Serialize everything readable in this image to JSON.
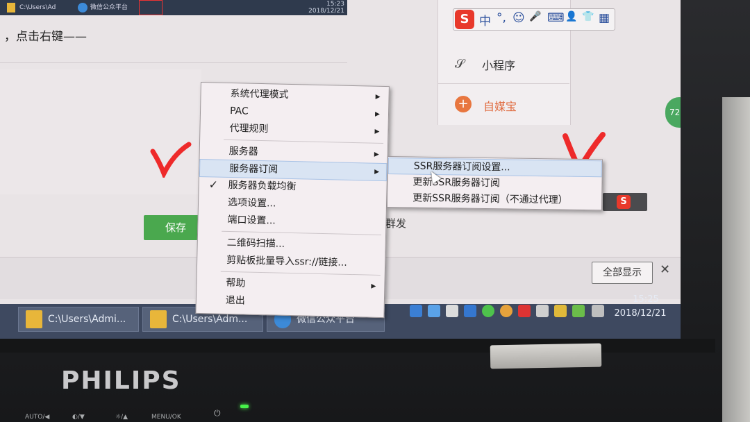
{
  "top_taskbar": {
    "items": [
      "C:\\Users\\Ad",
      "微信公众平台"
    ],
    "time": "15:23",
    "date": "2018/12/21"
  },
  "article": {
    "text": "，点击右键——",
    "save_label": "保存",
    "fa_label": "群发",
    "show_all_label": "全部显示",
    "close_label": "✕"
  },
  "side_menu": {
    "ime_logo": "S",
    "ime_icons": [
      "中",
      "°,",
      "☺",
      "🎤",
      "⌨",
      "👤",
      "👕",
      "▦"
    ],
    "mini_program": "小程序",
    "self_media": "自媒宝",
    "badge": "72"
  },
  "context_menu": {
    "items": [
      {
        "label": "系统代理模式",
        "has_arrow": true
      },
      {
        "label": "PAC",
        "has_arrow": true
      },
      {
        "label": "代理规则",
        "has_arrow": true
      },
      {
        "label": "服务器",
        "has_arrow": true
      },
      {
        "label": "服务器订阅",
        "has_arrow": true
      },
      {
        "label": "服务器负载均衡",
        "checked": true
      },
      {
        "label": "选项设置..."
      },
      {
        "label": "端口设置..."
      },
      {
        "label": "二维码扫描..."
      },
      {
        "label": "剪贴板批量导入ssr://链接..."
      },
      {
        "label": "帮助",
        "has_arrow": true
      },
      {
        "label": "退出"
      }
    ],
    "arrow_glyph": "▶",
    "check_glyph": "✓"
  },
  "submenu": {
    "items": [
      "SSR服务器订阅设置...",
      "更新SSR服务器订阅",
      "更新SSR服务器订阅（不通过代理）"
    ]
  },
  "taskbar": {
    "buttons": [
      "C:\\Users\\Admi...",
      "C:\\Users\\Adm...",
      "微信公众平台"
    ],
    "time": "15:25",
    "date": "2018/12/21"
  },
  "monitor": {
    "brand": "PHILIPS",
    "controls": [
      "AUTO/◀",
      "◐/▼",
      "☼/▲",
      "MENU/OK"
    ],
    "power_icon": "⏻"
  },
  "colors": {
    "save_green": "#4aa84e",
    "red_mark": "#ee2a2a",
    "menu_highlight": "#d9e4f3"
  }
}
